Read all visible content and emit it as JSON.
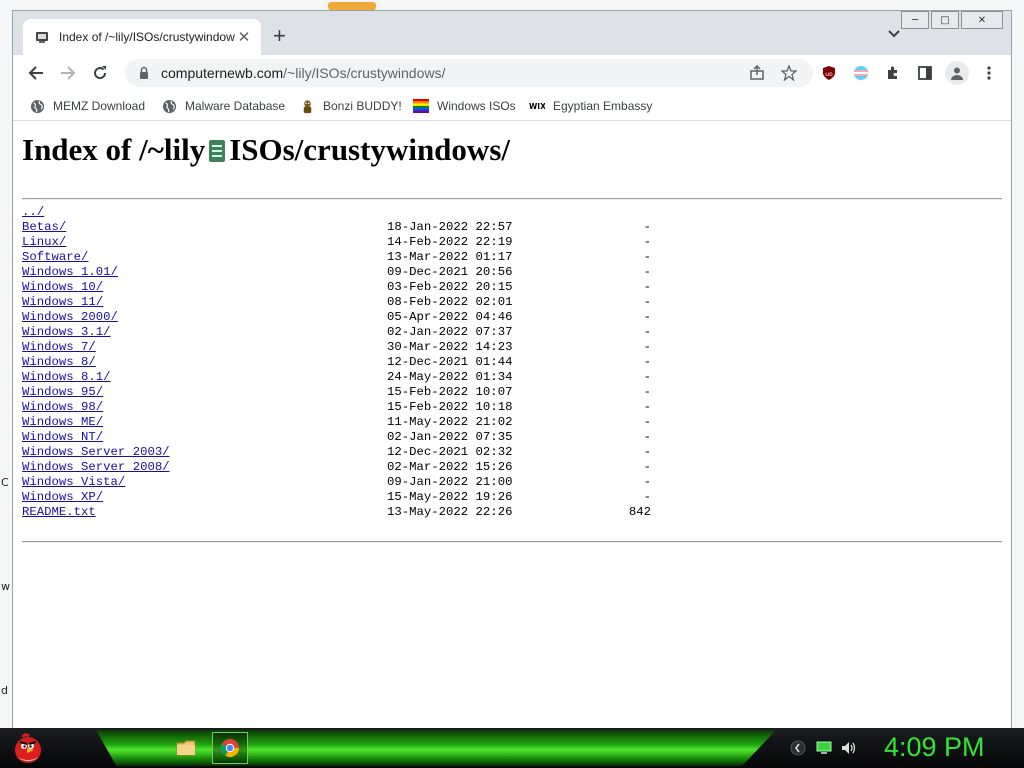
{
  "desktop": {
    "edge_letters": [
      "C",
      "w",
      "d"
    ]
  },
  "browser": {
    "tab": {
      "title": "Index of /~lily/ISOs/crustywindows/"
    },
    "window_buttons": {
      "minimize": "─",
      "maximize": "□",
      "close": "✕"
    },
    "address": {
      "host": "computernewb.com",
      "path": "/~lily/ISOs/crustywindows/"
    },
    "bookmarks": [
      {
        "label": "MEMZ Download",
        "icon": "globe-icon"
      },
      {
        "label": "Malware Database",
        "icon": "globe-icon"
      },
      {
        "label": "Bonzi BUDDY!",
        "icon": "bonzi-icon"
      },
      {
        "label": "Windows ISOs",
        "icon": "rainbow-flag-icon"
      },
      {
        "label": "Egyptian Embassy",
        "icon": "wix-icon"
      }
    ]
  },
  "page": {
    "heading_part1": "Index of /~lily",
    "heading_part2": "ISOs/crustywindows/",
    "parent_link": "../",
    "entries": [
      {
        "name": "Betas/",
        "date": "18-Jan-2022 22:57",
        "size": "-"
      },
      {
        "name": "Linux/",
        "date": "14-Feb-2022 22:19",
        "size": "-"
      },
      {
        "name": "Software/",
        "date": "13-Mar-2022 01:17",
        "size": "-"
      },
      {
        "name": "Windows 1.01/",
        "date": "09-Dec-2021 20:56",
        "size": "-"
      },
      {
        "name": "Windows 10/",
        "date": "03-Feb-2022 20:15",
        "size": "-"
      },
      {
        "name": "Windows 11/",
        "date": "08-Feb-2022 02:01",
        "size": "-"
      },
      {
        "name": "Windows 2000/",
        "date": "05-Apr-2022 04:46",
        "size": "-"
      },
      {
        "name": "Windows 3.1/",
        "date": "02-Jan-2022 07:37",
        "size": "-"
      },
      {
        "name": "Windows 7/",
        "date": "30-Mar-2022 14:23",
        "size": "-"
      },
      {
        "name": "Windows 8/",
        "date": "12-Dec-2021 01:44",
        "size": "-"
      },
      {
        "name": "Windows 8.1/",
        "date": "24-May-2022 01:34",
        "size": "-"
      },
      {
        "name": "Windows 95/",
        "date": "15-Feb-2022 10:07",
        "size": "-"
      },
      {
        "name": "Windows 98/",
        "date": "15-Feb-2022 10:18",
        "size": "-"
      },
      {
        "name": "Windows ME/",
        "date": "11-May-2022 21:02",
        "size": "-"
      },
      {
        "name": "Windows NT/",
        "date": "02-Jan-2022 07:35",
        "size": "-"
      },
      {
        "name": "Windows Server 2003/",
        "date": "12-Dec-2021 02:32",
        "size": "-"
      },
      {
        "name": "Windows Server 2008/",
        "date": "02-Mar-2022 15:26",
        "size": "-"
      },
      {
        "name": "Windows Vista/",
        "date": "09-Jan-2022 21:00",
        "size": "-"
      },
      {
        "name": "Windows XP/",
        "date": "15-May-2022 19:26",
        "size": "-"
      },
      {
        "name": "README.txt",
        "date": "13-May-2022 22:26",
        "size": "842"
      }
    ]
  },
  "taskbar": {
    "clock": "4:09 PM",
    "start_icon": "angry-bird-icon",
    "apps": [
      "folder-icon",
      "chrome-icon"
    ],
    "tray": [
      "tray-chevron-icon",
      "network-icon",
      "volume-icon"
    ]
  },
  "colors": {
    "link": "#1a0dab",
    "clock": "#33e533",
    "taskbar_accent": "#4fe52b"
  }
}
